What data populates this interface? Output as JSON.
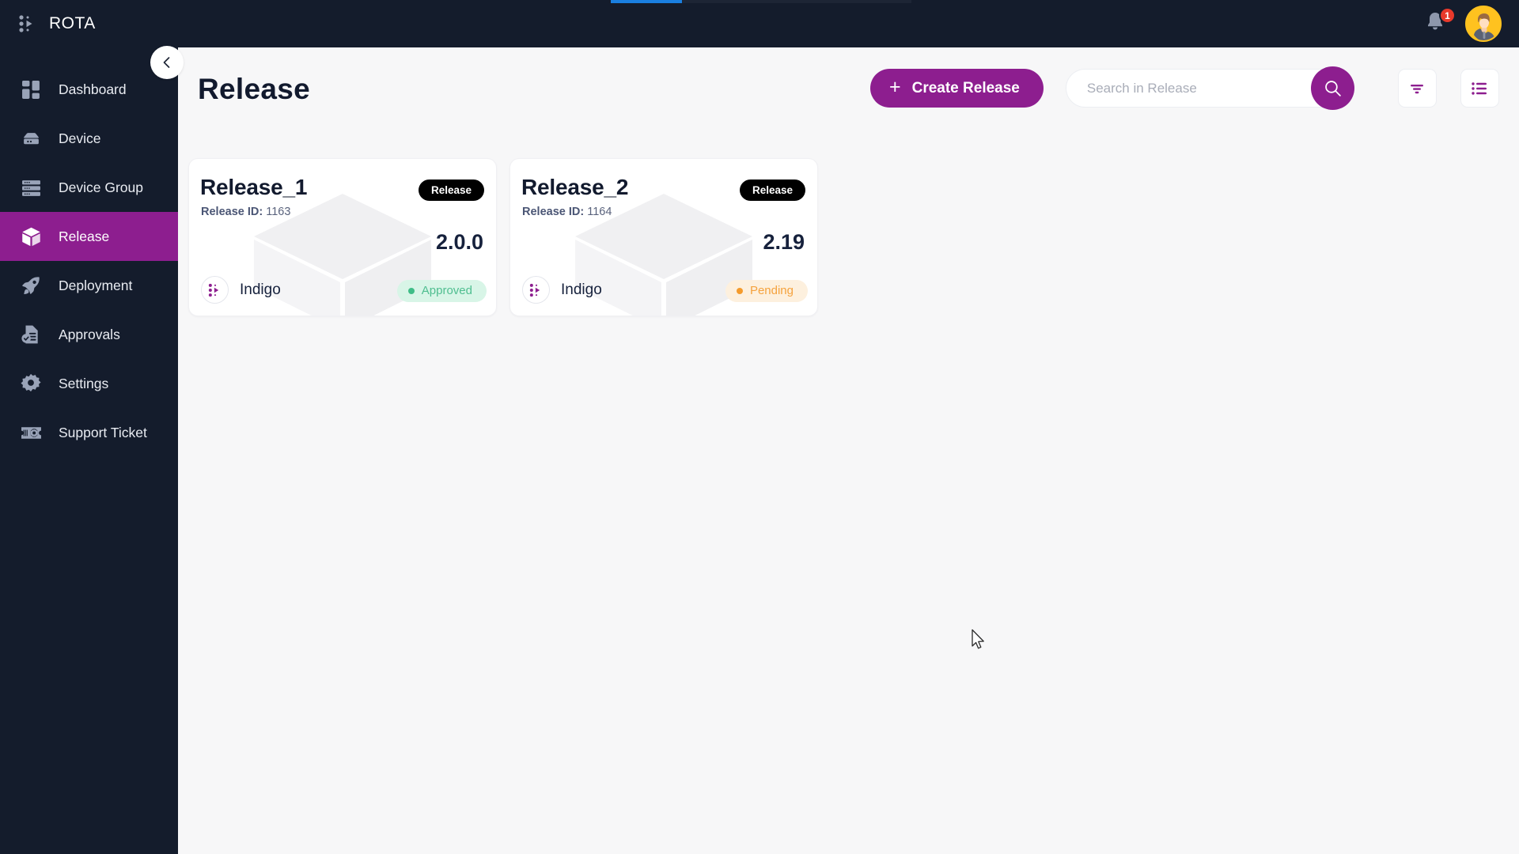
{
  "brand": {
    "name": "ROTA",
    "logo_icon": "rota-dots-play-icon"
  },
  "topbar": {
    "notification_icon": "bell-icon",
    "notification_count": "1",
    "avatar_icon": "user-avatar"
  },
  "loading_bar": {
    "color": "#1a7fe0"
  },
  "sidebar": {
    "collapse_icon": "chevron-left-icon",
    "items": [
      {
        "label": "Dashboard",
        "icon": "dashboard-grid-icon",
        "active": false
      },
      {
        "label": "Device",
        "icon": "device-icon",
        "active": false
      },
      {
        "label": "Device Group",
        "icon": "server-stack-icon",
        "active": false
      },
      {
        "label": "Release",
        "icon": "cube-box-icon",
        "active": true
      },
      {
        "label": "Deployment",
        "icon": "rocket-icon",
        "active": false
      },
      {
        "label": "Approvals",
        "icon": "document-check-icon",
        "active": false
      },
      {
        "label": "Settings",
        "icon": "gear-icon",
        "active": false
      },
      {
        "label": "Support Ticket",
        "icon": "ticket-gear-icon",
        "active": false
      }
    ]
  },
  "page": {
    "title": "Release"
  },
  "toolbar": {
    "create_label": "Create Release",
    "create_icon": "plus-icon",
    "search_placeholder": "Search in Release",
    "search_value": "",
    "search_icon": "magnifier-icon",
    "filter_icon": "filter-icon",
    "list_icon": "list-view-icon",
    "accent_color": "#8d1e8f"
  },
  "cards": [
    {
      "title": "Release_1",
      "id_label": "Release ID:",
      "id_value": "1163",
      "type_pill": "Release",
      "version": "2.0.0",
      "owner": "Indigo",
      "owner_icon": "rota-dots-play-icon",
      "status": "Approved",
      "status_kind": "approved"
    },
    {
      "title": "Release_2",
      "id_label": "Release ID:",
      "id_value": "1164",
      "type_pill": "Release",
      "version": "2.19",
      "owner": "Indigo",
      "owner_icon": "rota-dots-play-icon",
      "status": "Pending",
      "status_kind": "pending"
    }
  ]
}
